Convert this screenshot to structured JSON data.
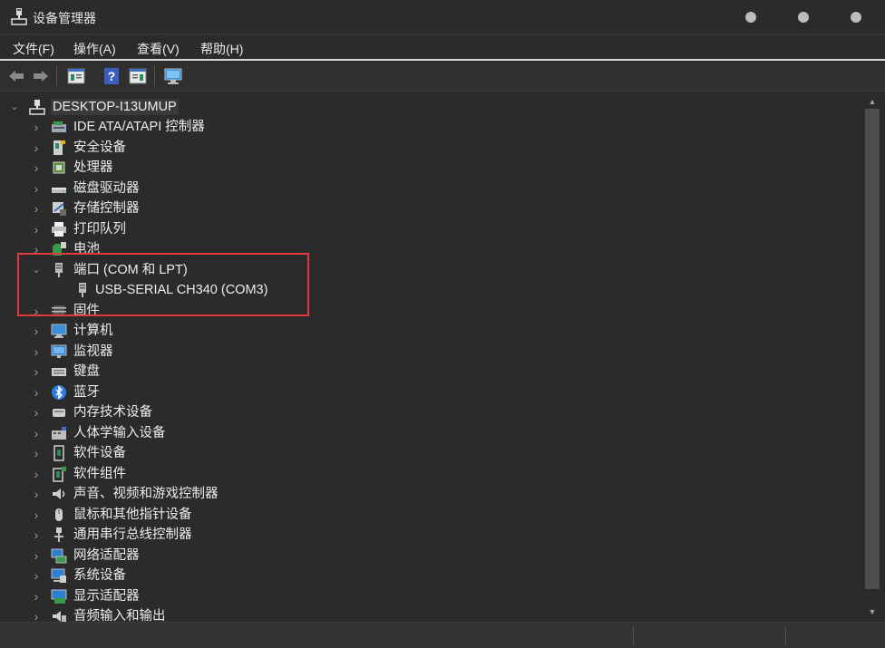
{
  "window": {
    "title": "设备管理器",
    "buttons": [
      "minimize",
      "maximize",
      "close"
    ]
  },
  "menu": {
    "items": [
      "文件(F)",
      "操作(A)",
      "查看(V)",
      "帮助(H)"
    ]
  },
  "toolbar": {
    "buttons": [
      "back-icon",
      "forward-icon",
      "properties-icon",
      "help-icon",
      "view-icon",
      "scan-hardware-icon"
    ]
  },
  "tree": {
    "root": {
      "label": "DESKTOP-I13UMUP",
      "expanded": true
    },
    "categories": [
      {
        "label": "IDE ATA/ATAPI 控制器",
        "icon": "ide-controller-icon",
        "expanded": false
      },
      {
        "label": "安全设备",
        "icon": "security-device-icon",
        "expanded": false
      },
      {
        "label": "处理器",
        "icon": "processor-icon",
        "expanded": false
      },
      {
        "label": "磁盘驱动器",
        "icon": "disk-drive-icon",
        "expanded": false
      },
      {
        "label": "存储控制器",
        "icon": "storage-controller-icon",
        "expanded": false
      },
      {
        "label": "打印队列",
        "icon": "print-queue-icon",
        "expanded": false
      },
      {
        "label": "电池",
        "icon": "battery-icon",
        "expanded": false
      },
      {
        "label": "端口 (COM 和 LPT)",
        "icon": "port-icon",
        "expanded": true,
        "children": [
          {
            "label": "USB-SERIAL CH340 (COM3)",
            "icon": "port-icon"
          }
        ]
      },
      {
        "label": "固件",
        "icon": "firmware-icon",
        "expanded": false
      },
      {
        "label": "计算机",
        "icon": "computer-icon",
        "expanded": false
      },
      {
        "label": "监视器",
        "icon": "monitor-icon",
        "expanded": false
      },
      {
        "label": "键盘",
        "icon": "keyboard-icon",
        "expanded": false
      },
      {
        "label": "蓝牙",
        "icon": "bluetooth-icon",
        "expanded": false
      },
      {
        "label": "内存技术设备",
        "icon": "memory-tech-icon",
        "expanded": false
      },
      {
        "label": "人体学输入设备",
        "icon": "hid-icon",
        "expanded": false
      },
      {
        "label": "软件设备",
        "icon": "software-device-icon",
        "expanded": false
      },
      {
        "label": "软件组件",
        "icon": "software-component-icon",
        "expanded": false
      },
      {
        "label": "声音、视频和游戏控制器",
        "icon": "sound-icon",
        "expanded": false
      },
      {
        "label": "鼠标和其他指针设备",
        "icon": "mouse-icon",
        "expanded": false
      },
      {
        "label": "通用串行总线控制器",
        "icon": "usb-icon",
        "expanded": false
      },
      {
        "label": "网络适配器",
        "icon": "network-adapter-icon",
        "expanded": false
      },
      {
        "label": "系统设备",
        "icon": "system-device-icon",
        "expanded": false
      },
      {
        "label": "显示适配器",
        "icon": "display-adapter-icon",
        "expanded": false
      },
      {
        "label": "音频输入和输出",
        "icon": "audio-io-icon",
        "expanded": false
      }
    ]
  },
  "annotation": {
    "color": "#e03a3a"
  },
  "colors": {
    "background": "#2b2b2b",
    "text": "#ececec"
  }
}
